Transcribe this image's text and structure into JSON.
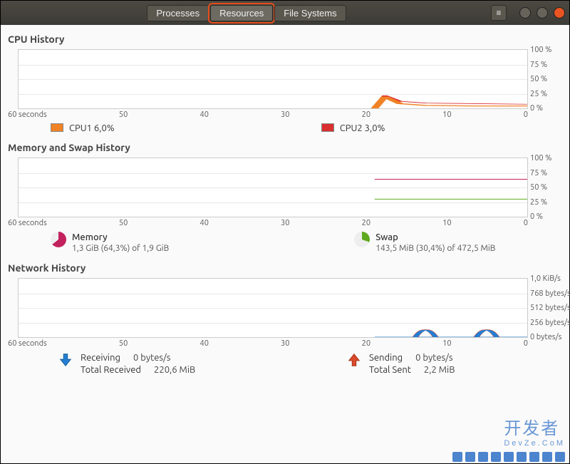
{
  "tabs": {
    "processes": "Processes",
    "resources": "Resources",
    "filesystems": "File Systems"
  },
  "x_axis": [
    "60 seconds",
    "50",
    "40",
    "30",
    "20",
    "10",
    "0"
  ],
  "cpu": {
    "title": "CPU History",
    "ylabels": [
      "100 %",
      "75 %",
      "50 %",
      "25 %",
      "0 %"
    ],
    "legend": [
      {
        "label": "CPU1  6,0%",
        "color": "#f08226"
      },
      {
        "label": "CPU2  3,0%",
        "color": "#d92f2f"
      }
    ]
  },
  "mem": {
    "title": "Memory and Swap History",
    "ylabels": [
      "100 %",
      "75 %",
      "50 %",
      "25 %",
      "0 %"
    ],
    "memory": {
      "title": "Memory",
      "sub": "1,3 GiB (64,3%) of 1,9 GiB",
      "percent": 64.3,
      "color": "#c3225e"
    },
    "swap": {
      "title": "Swap",
      "sub": "143,5 MiB (30,4%) of 472,5 MiB",
      "percent": 30.4,
      "color": "#5ea91e"
    }
  },
  "net": {
    "title": "Network History",
    "ylabels": [
      "1,0 KiB/s",
      "768 bytes/s",
      "512 bytes/s",
      "256 bytes/s",
      "0 bytes/s"
    ],
    "recv": {
      "title": "Receiving",
      "rate": "0 bytes/s",
      "total_label": "Total Received",
      "total": "220,6 MiB",
      "color": "#247fd4"
    },
    "send": {
      "title": "Sending",
      "rate": "0 bytes/s",
      "total_label": "Total Sent",
      "total": "2,2 MiB",
      "color": "#d94a2b"
    }
  },
  "chart_data": [
    {
      "type": "line",
      "title": "CPU History",
      "xlabel": "seconds",
      "ylabel": "%",
      "ylim": [
        0,
        100
      ],
      "x": [
        60,
        50,
        40,
        30,
        20,
        18,
        17,
        15,
        10,
        5,
        0
      ],
      "series": [
        {
          "name": "CPU1",
          "values": [
            null,
            null,
            null,
            null,
            null,
            0,
            22,
            12,
            9,
            8,
            7
          ]
        },
        {
          "name": "CPU2",
          "values": [
            null,
            null,
            null,
            null,
            null,
            0,
            20,
            8,
            5,
            4,
            4
          ]
        }
      ]
    },
    {
      "type": "line",
      "title": "Memory and Swap History",
      "xlabel": "seconds",
      "ylabel": "%",
      "ylim": [
        0,
        100
      ],
      "x": [
        60,
        50,
        40,
        30,
        20,
        15,
        10,
        5,
        0
      ],
      "series": [
        {
          "name": "Memory",
          "values": [
            null,
            null,
            null,
            null,
            null,
            64,
            64,
            64,
            64
          ]
        },
        {
          "name": "Swap",
          "values": [
            null,
            null,
            null,
            null,
            null,
            30,
            30,
            30,
            30
          ]
        }
      ]
    },
    {
      "type": "line",
      "title": "Network History",
      "xlabel": "seconds",
      "ylabel": "bytes/s",
      "ylim": [
        0,
        1024
      ],
      "x": [
        60,
        50,
        40,
        30,
        20,
        14,
        12,
        10,
        8,
        6,
        4,
        2,
        0
      ],
      "series": [
        {
          "name": "Receiving",
          "values": [
            null,
            null,
            null,
            null,
            null,
            0,
            250,
            0,
            0,
            0,
            250,
            0,
            0
          ]
        },
        {
          "name": "Sending",
          "values": [
            null,
            null,
            null,
            null,
            null,
            0,
            240,
            0,
            0,
            0,
            240,
            0,
            0
          ]
        }
      ]
    }
  ],
  "watermark": {
    "line1": "开发者",
    "line2": "DevZe.CoM"
  }
}
